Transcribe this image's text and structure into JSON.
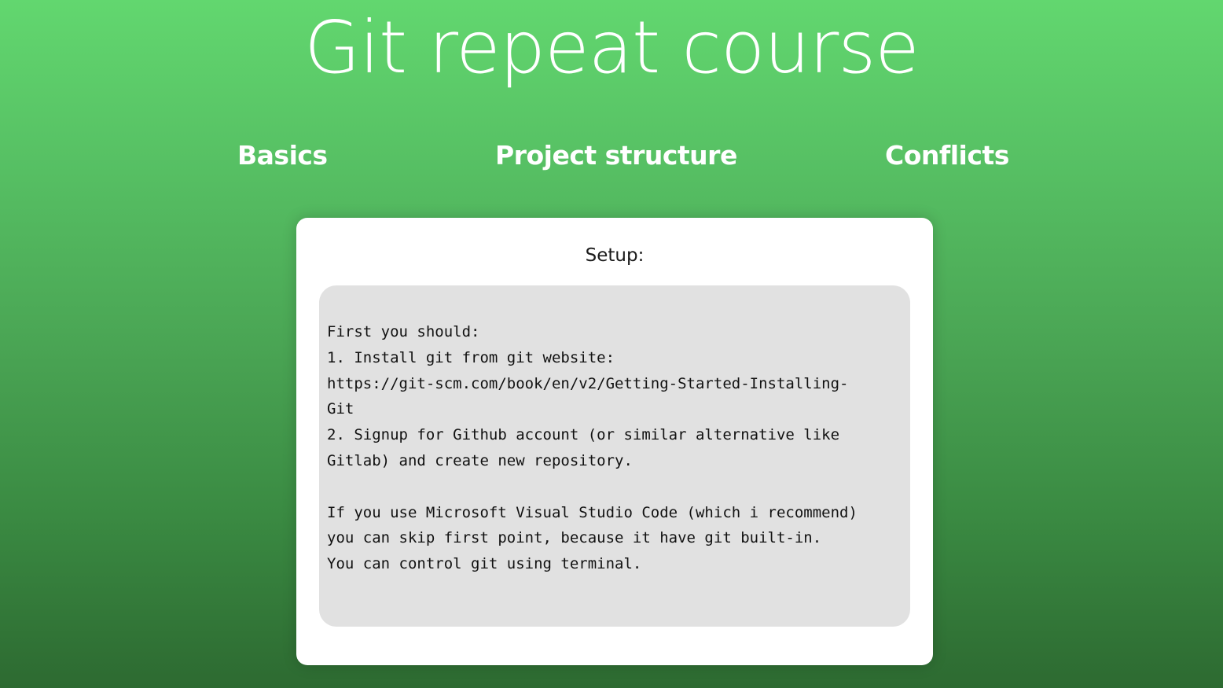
{
  "header": {
    "title": "Git repeat course"
  },
  "nav": {
    "items": [
      {
        "label": "Basics"
      },
      {
        "label": "Project structure"
      },
      {
        "label": "Conflicts"
      }
    ]
  },
  "card": {
    "heading": "Setup:",
    "lines": [
      "First you should:",
      "1. Install git from git website:",
      "https://git-scm.com/book/en/v2/Getting-Started-Installing-",
      "Git",
      "2. Signup for Github account (or similar alternative like",
      "Gitlab) and create new repository.",
      "",
      "If you use Microsoft Visual Studio Code (which i recommend)",
      "you can skip first point, because it have git built-in.",
      "You can control git using terminal."
    ]
  }
}
